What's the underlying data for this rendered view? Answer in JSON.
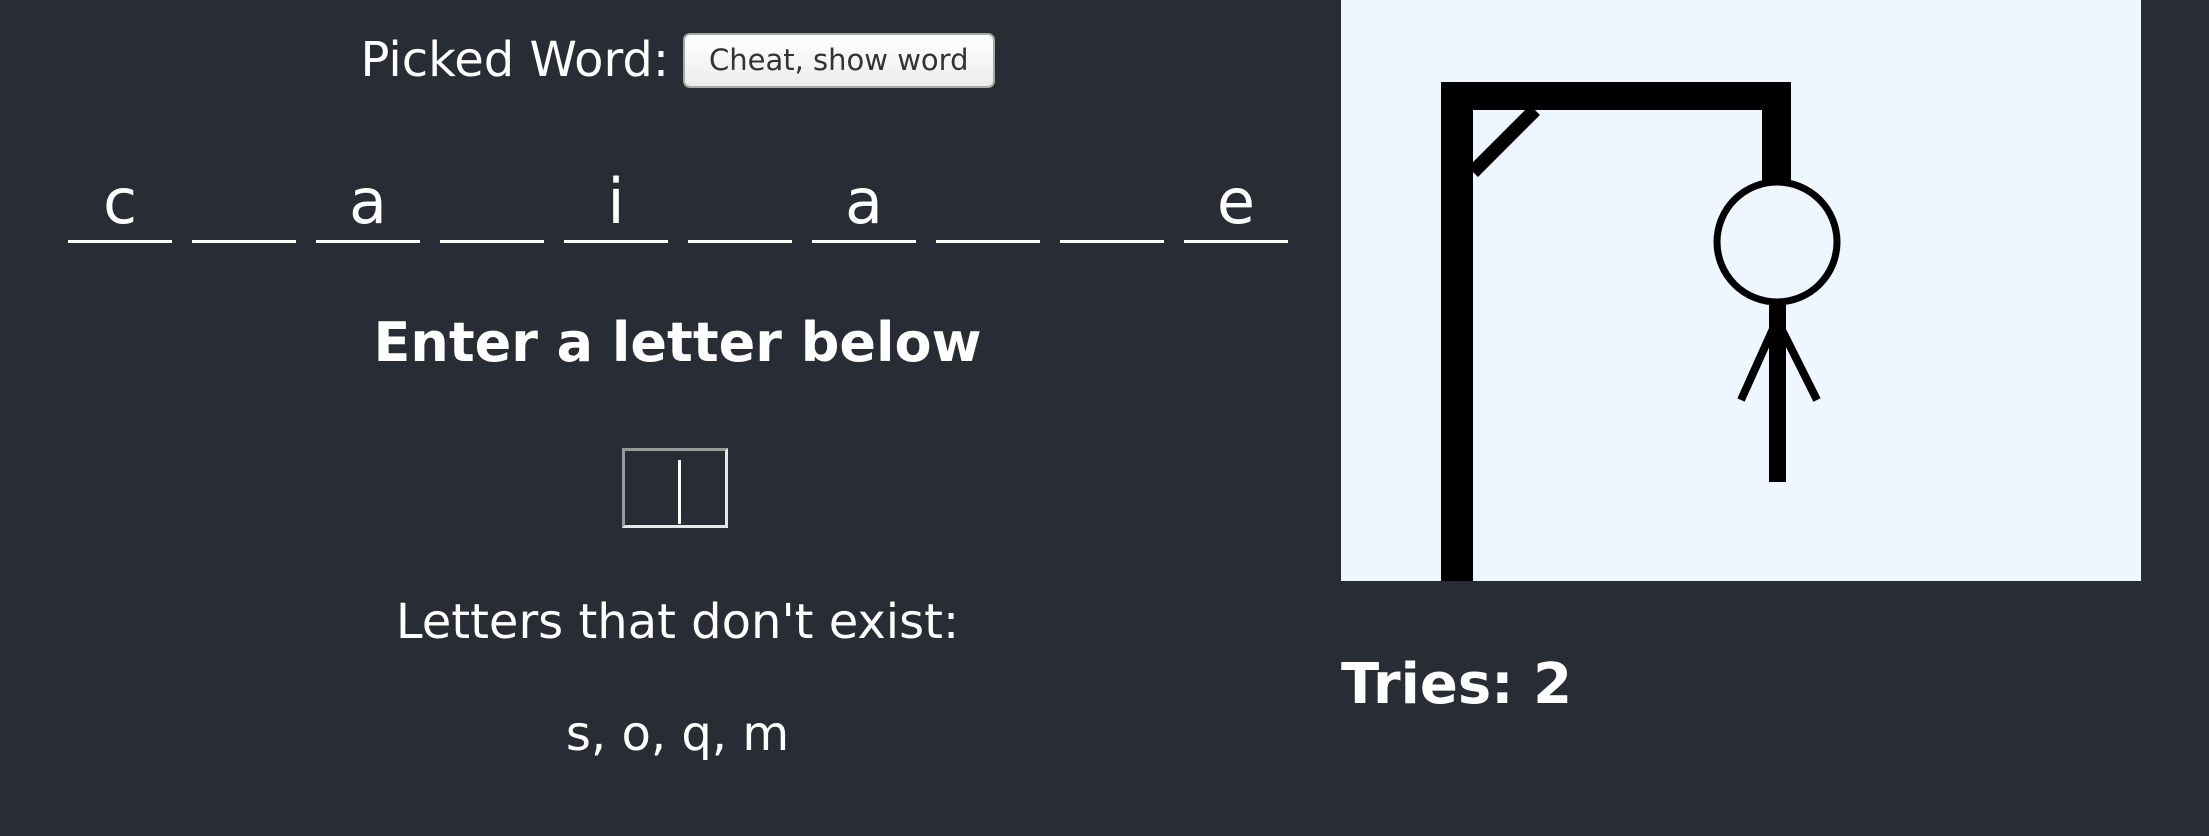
{
  "header": {
    "picked_word_label": "Picked Word:",
    "cheat_button_label": "Cheat, show word"
  },
  "word": {
    "letters": [
      "c",
      "",
      "a",
      "",
      "i",
      "",
      "a",
      "",
      "",
      "e"
    ]
  },
  "prompt": {
    "heading": "Enter a letter below"
  },
  "input": {
    "value": ""
  },
  "missing": {
    "label": "Letters that don't exist:",
    "letters": "s, o, q, m"
  },
  "status": {
    "tries_text": "Tries: 2",
    "tries_count": 2
  },
  "colors": {
    "background": "#282c34",
    "text": "#ffffff",
    "gallows_panel": "#eef6ff",
    "gallows_stroke": "#000000"
  }
}
